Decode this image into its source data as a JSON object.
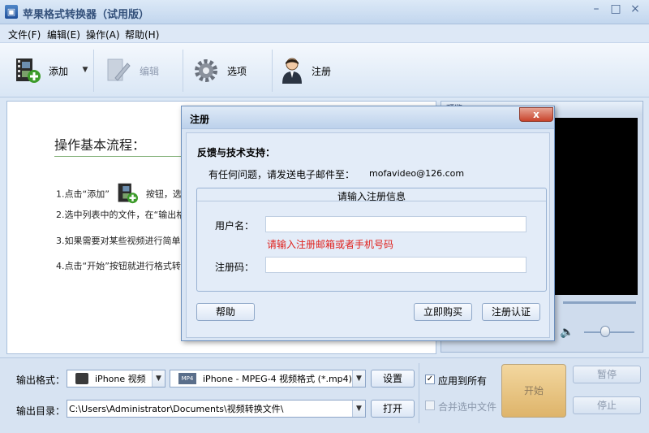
{
  "window": {
    "title": "苹果格式转换器（试用版）",
    "minimize": "–",
    "maximize": "□",
    "close": "×"
  },
  "menu": [
    "文件(F)",
    "编辑(E)",
    "操作(A)",
    "帮助(H)"
  ],
  "toolbar": {
    "add": "添加",
    "edit": "编辑",
    "options": "选项",
    "register": "注册"
  },
  "intro": {
    "title": "操作基本流程：",
    "step1a": "1.点击“添加”",
    "step1b": "按钮，选择",
    "step2": "2.选中列表中的文件，在“输出格",
    "step3": "3.如果需要对某些视频进行简单编",
    "step4": "4.点击“开始”按钮就进行格式转"
  },
  "preview": {
    "header": "预览"
  },
  "bottom": {
    "output_format_label": "输出格式：",
    "device_value": "iPhone 视频",
    "format_value": "iPhone - MPEG-4 视频格式 (*.mp4)",
    "settings_button": "设置",
    "output_dir_label": "输出目录：",
    "output_dir_value": "C:\\Users\\Administrator\\Documents\\视频转换文件\\",
    "open_button": "打开",
    "apply_all_label": "应用到所有",
    "merge_label": "合并选中文件",
    "start_button": "开始",
    "pause_button": "暂停",
    "stop_button": "停止"
  },
  "dialog": {
    "title": "注册",
    "close": "x",
    "support_heading": "反馈与技术支持：",
    "support_text": "有任何问题，请发送电子邮件至：",
    "support_email": "mofavideo@126.com",
    "fieldset_legend": "请输入注册信息",
    "username_label": "用户名：",
    "username_value": "",
    "hint": "请输入注册邮箱或者手机号码",
    "code_label": "注册码：",
    "code_value": "",
    "help_button": "帮助",
    "buy_button": "立即购买",
    "verify_button": "注册认证"
  },
  "colors": {
    "accent": "#d9e5f4",
    "hint_red": "#e0201c",
    "start_bg": "#deb46a"
  }
}
